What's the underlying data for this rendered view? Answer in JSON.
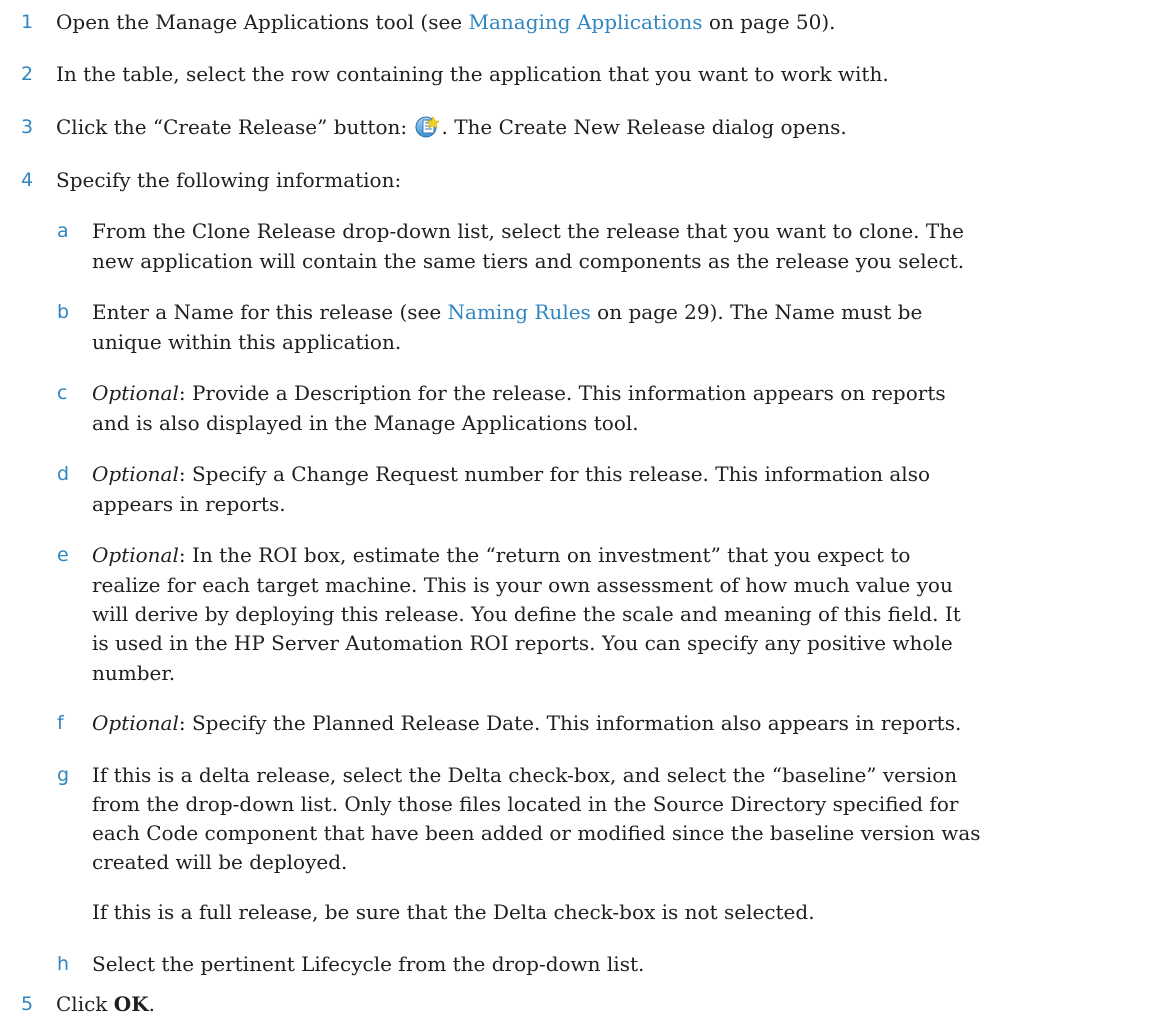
{
  "steps": [
    {
      "num": "1",
      "pre": "Open the Manage Applications tool (see ",
      "link": "Managing Applications",
      "post": " on page 50)."
    },
    {
      "num": "2",
      "text": "In the table, select the row containing the application that you want to work with."
    },
    {
      "num": "3",
      "pre": "Click the “Create Release” button: ",
      "icon": "create-release-icon",
      "post": ". The Create New Release dialog opens."
    },
    {
      "num": "4",
      "text": "Specify the following information:"
    },
    {
      "num": "5",
      "pre": "Click ",
      "bold": "OK",
      "post": "."
    }
  ],
  "substeps": {
    "a": {
      "letter": "a",
      "lines": [
        "From the Clone Release drop-down list, select the release that you want to clone. The",
        "new application will contain the same tiers and components as the release you select."
      ]
    },
    "b": {
      "letter": "b",
      "pre": "Enter a Name for this release (see ",
      "link": "Naming Rules",
      "post": " on page 29). The Name must be",
      "line2": "unique within this application."
    },
    "c": {
      "letter": "c",
      "optional": "Optional",
      "line1": ": Provide a Description for the release. This information appears on reports",
      "line2": "and is also displayed in the Manage Applications tool."
    },
    "d": {
      "letter": "d",
      "optional": "Optional",
      "line1": ": Specify a Change Request number for this release. This information also",
      "line2": "appears in reports."
    },
    "e": {
      "letter": "e",
      "optional": "Optional",
      "line1": ": In the ROI box, estimate the “return on investment” that you expect to",
      "lines": [
        "realize for each target machine. This is your own assessment of how much value you",
        "will derive by deploying this release. You define the scale and meaning of this field. It",
        "is used in the HP Server Automation ROI reports. You can specify any positive whole",
        "number."
      ]
    },
    "f": {
      "letter": "f",
      "optional": "Optional",
      "line1": ": Specify the Planned Release Date. This information also appears in reports."
    },
    "g": {
      "letter": "g",
      "lines": [
        "If this is a delta release, select the Delta check-box, and select the “baseline” version",
        "from the drop-down list. Only those files located in the Source Directory specified for",
        "each Code component that have been added or modified since the baseline version was",
        "created will be deployed."
      ],
      "note": "If this is a full release, be sure that the Delta check-box is not selected."
    },
    "h": {
      "letter": "h",
      "text": "Select the pertinent Lifecycle from the drop-down list."
    }
  }
}
